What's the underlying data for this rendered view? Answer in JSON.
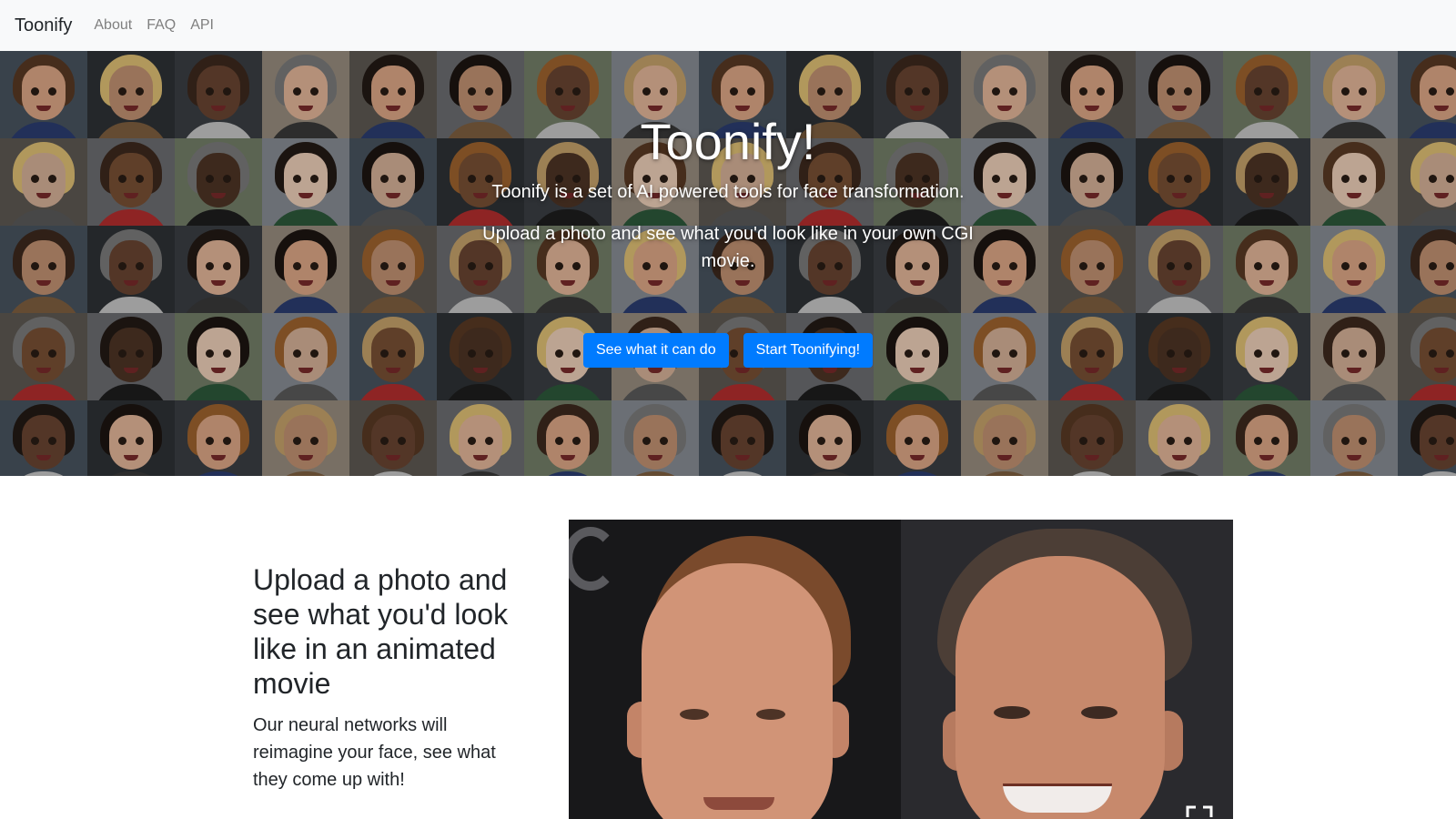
{
  "navbar": {
    "brand": "Toonify",
    "links": [
      "About",
      "FAQ",
      "API"
    ]
  },
  "hero": {
    "title": "Toonify!",
    "lead": "Toonify is a set of AI powered tools for face transformation.",
    "lead2": "Upload a photo and see what you'd look like in your own CGI movie.",
    "buttons": {
      "see": "See what it can do",
      "start": "Start Toonifying!"
    }
  },
  "feature": {
    "heading": "Upload a photo and see what you'd look like in an animated movie",
    "body": "Our neural networks will reimagine your face, see what they come up with!"
  },
  "colors": {
    "accent": "#007bff",
    "navbar_bg": "#f8f9fa"
  },
  "icons": {
    "expand": "expand-icon"
  }
}
